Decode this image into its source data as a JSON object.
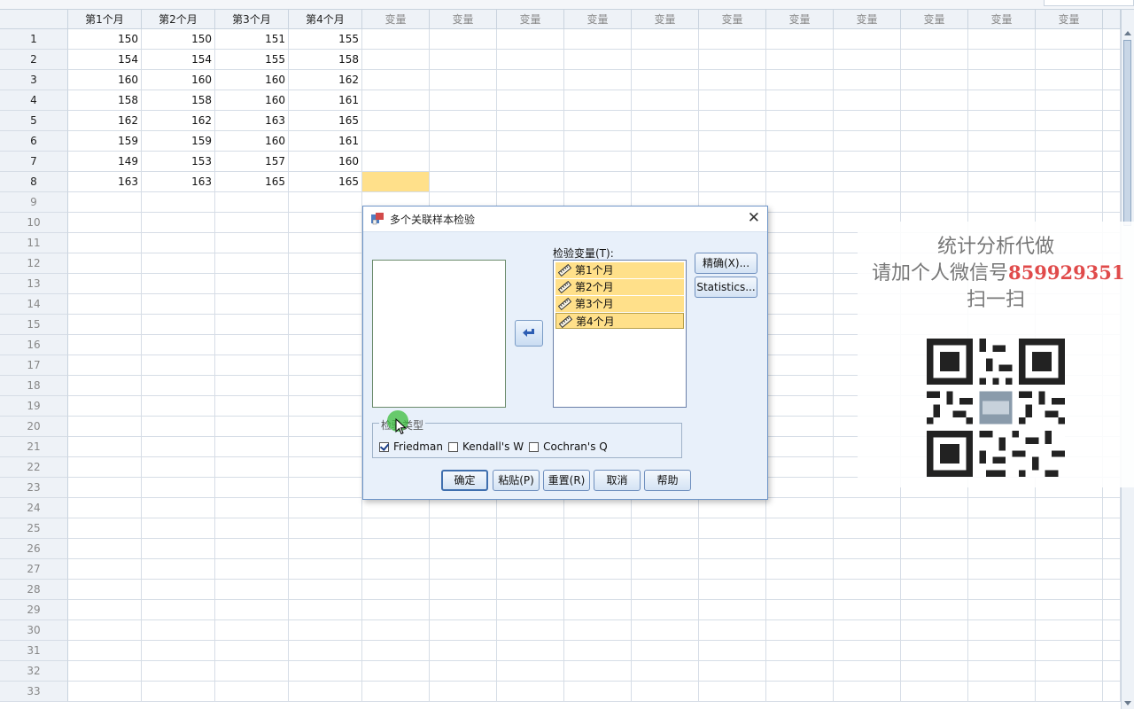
{
  "grid": {
    "columns": [
      {
        "label": "第1个月"
      },
      {
        "label": "第2个月"
      },
      {
        "label": "第3个月"
      },
      {
        "label": "第4个月"
      },
      {
        "label": "变量"
      },
      {
        "label": "变量"
      },
      {
        "label": "变量"
      },
      {
        "label": "变量"
      },
      {
        "label": "变量"
      },
      {
        "label": "变量"
      },
      {
        "label": "变量"
      },
      {
        "label": "变量"
      },
      {
        "label": "变量"
      },
      {
        "label": "变量"
      },
      {
        "label": "变量"
      }
    ],
    "rows": [
      {
        "num": "1",
        "values": [
          "150",
          "150",
          "151",
          "155"
        ]
      },
      {
        "num": "2",
        "values": [
          "154",
          "154",
          "155",
          "158"
        ]
      },
      {
        "num": "3",
        "values": [
          "160",
          "160",
          "160",
          "162"
        ]
      },
      {
        "num": "4",
        "values": [
          "158",
          "158",
          "160",
          "161"
        ]
      },
      {
        "num": "5",
        "values": [
          "162",
          "162",
          "163",
          "165"
        ]
      },
      {
        "num": "6",
        "values": [
          "159",
          "159",
          "160",
          "161"
        ]
      },
      {
        "num": "7",
        "values": [
          "149",
          "153",
          "157",
          "160"
        ]
      },
      {
        "num": "8",
        "values": [
          "163",
          "163",
          "165",
          "165"
        ]
      }
    ],
    "empty_row_nums": [
      "9",
      "10",
      "11",
      "12",
      "13",
      "14",
      "15",
      "16",
      "17",
      "18",
      "19",
      "20",
      "21",
      "22",
      "23",
      "24",
      "25",
      "26",
      "27",
      "28",
      "29",
      "30",
      "31",
      "32",
      "33"
    ],
    "selected_color": "#ffe08a"
  },
  "dialog": {
    "title": "多个关联样本检验",
    "close_label": "✕",
    "test_variables_label": "检验变量(T):",
    "test_variables": [
      "第1个月",
      "第2个月",
      "第3个月",
      "第4个月"
    ],
    "exact_button": "精确(X)...",
    "statistics_button": "Statistics...",
    "test_type_label": "检验类型",
    "checkboxes": [
      {
        "label": "Friedman",
        "checked": true
      },
      {
        "label": "Kendall's W",
        "checked": false
      },
      {
        "label": "Cochran's Q",
        "checked": false
      }
    ],
    "buttons": {
      "ok": "确定",
      "paste": "粘贴(P)",
      "reset": "重置(R)",
      "cancel": "取消",
      "help": "帮助"
    }
  },
  "watermark": {
    "line1": "统计分析代做",
    "line2_prefix": "请加个人微信号",
    "line2_number": "859929351",
    "line3": "扫一扫"
  }
}
